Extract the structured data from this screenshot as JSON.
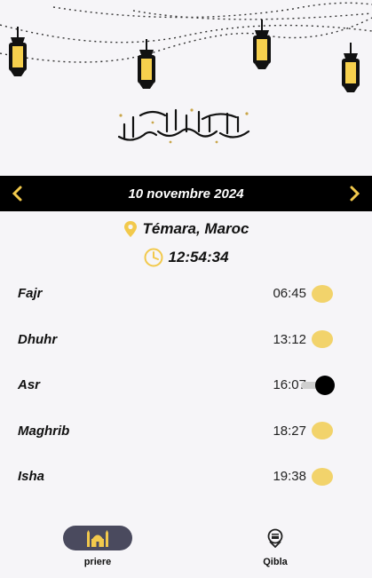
{
  "header": {
    "date": "10 novembre 2024"
  },
  "location": "Témara, Maroc",
  "clock": "12:54:34",
  "prayers": [
    {
      "name": "Fajr",
      "time": "06:45",
      "notification_on": true
    },
    {
      "name": "Dhuhr",
      "time": "13:12",
      "notification_on": true
    },
    {
      "name": "Asr",
      "time": "16:07",
      "notification_on": false
    },
    {
      "name": "Maghrib",
      "time": "18:27",
      "notification_on": true
    },
    {
      "name": "Isha",
      "time": "19:38",
      "notification_on": true
    }
  ],
  "bottom_nav": {
    "prayer_label": "priere",
    "qibla_label": "Qibla",
    "active": "priere"
  },
  "colors": {
    "accent": "#f2d36b",
    "bar": "#000000",
    "pill": "#4a4a5e"
  },
  "icons": {
    "prev": "chevron-left-icon",
    "next": "chevron-right-icon",
    "location": "location-pin-icon",
    "clock": "clock-icon",
    "prayer_tab": "mosque-icon",
    "qibla_tab": "kaaba-icon"
  }
}
